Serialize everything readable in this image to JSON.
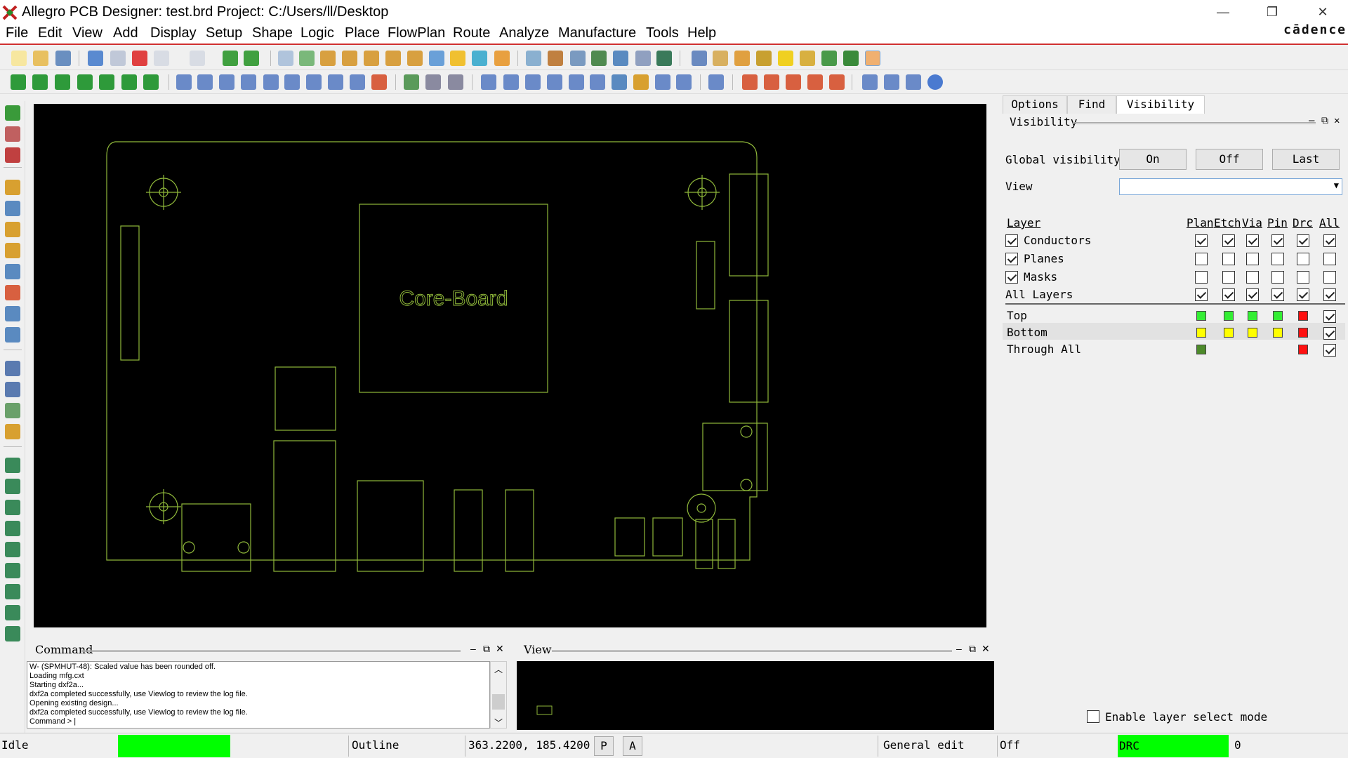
{
  "window": {
    "title": "Allegro PCB Designer: test.brd  Project: C:/Users/ll/Desktop",
    "minimize": "—",
    "restore": "❐",
    "close": "✕"
  },
  "menu": [
    "File",
    "Edit",
    "View",
    "Add",
    "Display",
    "Setup",
    "Shape",
    "Logic",
    "Place",
    "FlowPlan",
    "Route",
    "Analyze",
    "Manufacture",
    "Tools",
    "Help"
  ],
  "brand": "cādence",
  "canvas": {
    "board_label": "Core-Board",
    "background": "#000000",
    "outline_color": "#8fb83a"
  },
  "right_panel": {
    "tabs": [
      "Options",
      "Find",
      "Visibility"
    ],
    "active_tab": "Visibility",
    "section_title": "Visibility",
    "global_visibility_label": "Global visibility",
    "buttons": [
      "On",
      "Off",
      "Last"
    ],
    "view_label": "View",
    "view_value": "",
    "columns": [
      "Layer",
      "Plan",
      "Etch",
      "Via",
      "Pin",
      "Drc",
      "All"
    ],
    "groups": [
      {
        "label": "Conductors",
        "checked": true,
        "cols": [
          true,
          true,
          true,
          true,
          true,
          true
        ]
      },
      {
        "label": "Planes",
        "checked": true,
        "cols": [
          false,
          false,
          false,
          false,
          false,
          false
        ]
      },
      {
        "label": "Masks",
        "checked": true,
        "cols": [
          false,
          false,
          false,
          false,
          false,
          false
        ]
      },
      {
        "label": "All Layers",
        "checked": null,
        "cols": [
          true,
          true,
          true,
          true,
          true,
          true
        ]
      }
    ],
    "layers": [
      {
        "label": "Top",
        "colors": [
          "#33ee33",
          "#33ee33",
          "#33ee33",
          "#33ee33",
          "#ff1111"
        ],
        "all": true
      },
      {
        "label": "Bottom",
        "colors": [
          "#ffff00",
          "#ffff00",
          "#ffff00",
          "#ffff00",
          "#ff1111"
        ],
        "all": true
      },
      {
        "label": "Through All",
        "colors": [
          "#4d8a2a",
          null,
          null,
          null,
          "#ff1111"
        ],
        "all": true
      }
    ],
    "enable_layer_select": "Enable layer select mode"
  },
  "command": {
    "title": "Command",
    "lines": [
      "W- (SPMHUT-48): Scaled value has been rounded off.",
      "Loading mfg.cxt",
      "Starting dxf2a...",
      "dxf2a completed successfully, use Viewlog to review the log file.",
      "Opening existing design...",
      "dxf2a completed successfully, use Viewlog to review the log file.",
      "Command > "
    ]
  },
  "view_panel": {
    "title": "View"
  },
  "status": {
    "state": "Idle",
    "state_color": "#00ff00",
    "class": "Outline",
    "coords": "363.2200,  185.4200",
    "p_btn": "P",
    "a_btn": "A",
    "mode": "General edit",
    "off": "Off",
    "drc_label": "DRC",
    "drc_color": "#00ff00",
    "drc_count": "0"
  }
}
